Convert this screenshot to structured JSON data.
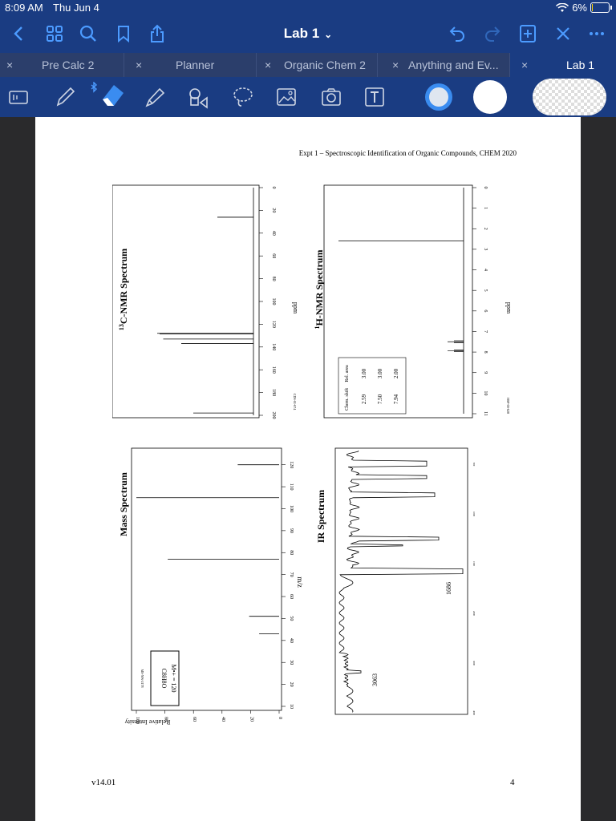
{
  "status": {
    "time": "8:09 AM",
    "date": "Thu Jun 4",
    "battery": "6%",
    "battery_level": 0.06
  },
  "nav": {
    "title": "Lab 1"
  },
  "tabs": [
    {
      "label": "Pre Calc 2"
    },
    {
      "label": "Planner"
    },
    {
      "label": "Organic Chem 2"
    },
    {
      "label": "Anything and Ev..."
    },
    {
      "label": "Lab 1"
    }
  ],
  "doc": {
    "header": "Expt 1 – Spectroscopic Identification of Organic Compounds, CHEM 2020",
    "version": "v14.01",
    "page_number": "4"
  },
  "c13": {
    "title": "13C-NMR Spectrum",
    "title_sup": "13",
    "title_rest": "C-NMR Spectrum",
    "ticks": [
      "0",
      "20",
      "40",
      "60",
      "80",
      "100",
      "120",
      "140",
      "160",
      "180",
      "200"
    ],
    "unit": "ppm",
    "code": "CDS-01-674"
  },
  "h1": {
    "title_sup": "1",
    "title_rest": "H-NMR Spectrum",
    "ticks": [
      "0",
      "1",
      "2",
      "3",
      "4",
      "5",
      "6",
      "7",
      "8",
      "9",
      "10",
      "11"
    ],
    "unit": "ppm",
    "code": "HSP-00-628",
    "table": {
      "headers": [
        "Chem. shift",
        "Rel. area"
      ],
      "rows": [
        [
          "2.59",
          "3.00"
        ],
        [
          "7.50",
          "3.00"
        ],
        [
          "7.94",
          "2.00"
        ]
      ]
    }
  },
  "ms": {
    "title": "Mass Spectrum",
    "yticks": [
      "0",
      "20",
      "40",
      "60",
      "80",
      "100"
    ],
    "ylabel": "Relative Intensity",
    "xticks": [
      "10",
      "20",
      "30",
      "40",
      "50",
      "60",
      "70",
      "80",
      "90",
      "100",
      "110",
      "120"
    ],
    "xlabel": "m/z",
    "code": "MS-NW-2178",
    "formula": "C8H8O",
    "mplus": "M•+ = 120"
  },
  "ir": {
    "title": "IR Spectrum",
    "peak_labels": [
      "1686",
      "3063"
    ],
    "xticks": [
      "4000",
      "3000",
      "2000",
      "1500",
      "1000",
      "500"
    ]
  },
  "chart_data": [
    {
      "type": "bar",
      "title": "13C-NMR Spectrum",
      "xlabel": "ppm",
      "xlim": [
        0,
        200
      ],
      "x": [
        26,
        128,
        128.5,
        133,
        137,
        198
      ],
      "values": [
        0.3,
        0.8,
        0.78,
        0.75,
        0.6,
        0.5
      ]
    },
    {
      "type": "line",
      "title": "1H-NMR Spectrum",
      "xlabel": "ppm",
      "xlim": [
        0,
        11
      ],
      "x": [
        2.59,
        7.5,
        7.94
      ],
      "values": [
        1.0,
        0.08,
        0.06
      ]
    },
    {
      "type": "bar",
      "title": "Mass Spectrum",
      "xlabel": "m/z",
      "ylabel": "Relative Intensity",
      "ylim": [
        0,
        100
      ],
      "x": [
        43,
        51,
        77,
        105,
        120
      ],
      "values": [
        14,
        21,
        78,
        100,
        29
      ]
    },
    {
      "type": "line",
      "title": "IR Spectrum",
      "annotations": [
        "1686",
        "3063"
      ]
    }
  ]
}
